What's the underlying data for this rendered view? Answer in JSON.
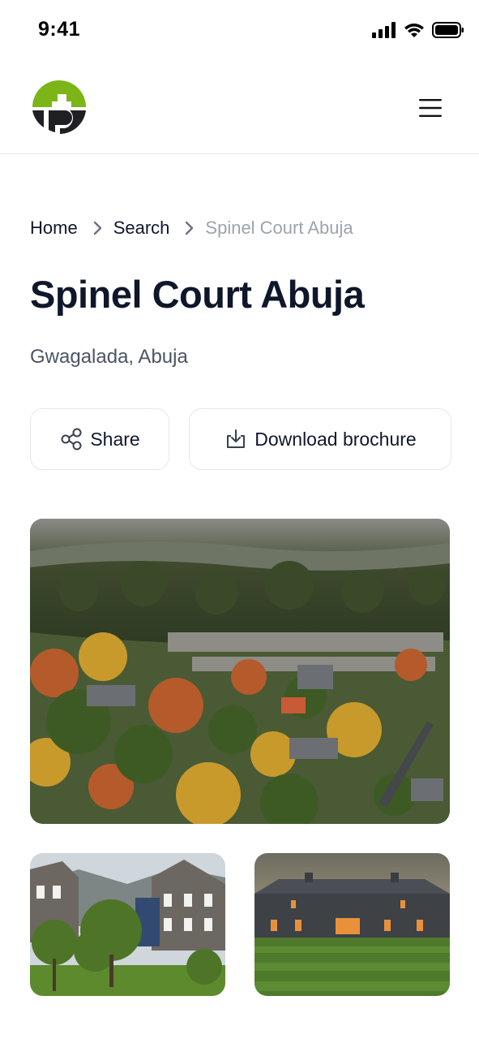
{
  "status_bar": {
    "time": "9:41",
    "icons": [
      "signal-icon",
      "wifi-icon",
      "battery-icon"
    ]
  },
  "header": {
    "logo": "brand-logo",
    "menu_icon": "hamburger-menu-icon",
    "logo_colors": {
      "green": "#7cb518",
      "dark": "#1f1f24"
    }
  },
  "breadcrumb": {
    "items": [
      "Home",
      "Search",
      "Spinel Court Abuja"
    ]
  },
  "property": {
    "title": "Spinel Court Abuja",
    "location": "Gwagalada, Abuja"
  },
  "actions": {
    "share_label": "Share",
    "share_icon": "share-icon",
    "download_label": "Download brochure",
    "download_icon": "download-icon"
  },
  "gallery": {
    "images": [
      "aerial-town-autumn-photo",
      "victorian-houses-photo",
      "barn-house-lawn-photo"
    ]
  },
  "colors": {
    "text_primary": "#0f172a",
    "text_secondary": "#4b5563",
    "text_muted": "#9ca3af",
    "border": "#e5e7eb"
  }
}
